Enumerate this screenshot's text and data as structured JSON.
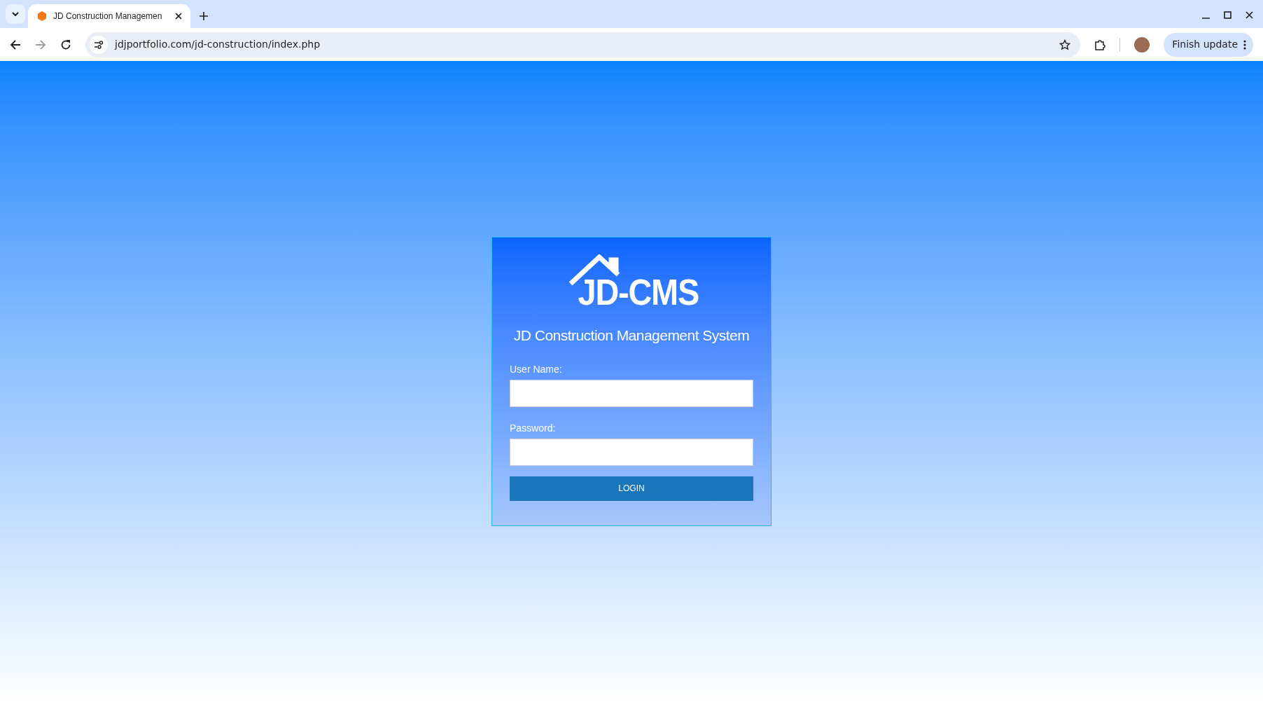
{
  "browser": {
    "tab": {
      "title": "JD Construction Managemen",
      "selected": true
    },
    "url": "jdjportfolio.com/jd-construction/index.php",
    "update_button": "Finish update"
  },
  "login": {
    "logo": "JD-CMS",
    "title": "JD Construction Management System",
    "fields": [
      {
        "label": "User Name:"
      },
      {
        "label": "Password:"
      }
    ],
    "button": "LOGIN"
  }
}
